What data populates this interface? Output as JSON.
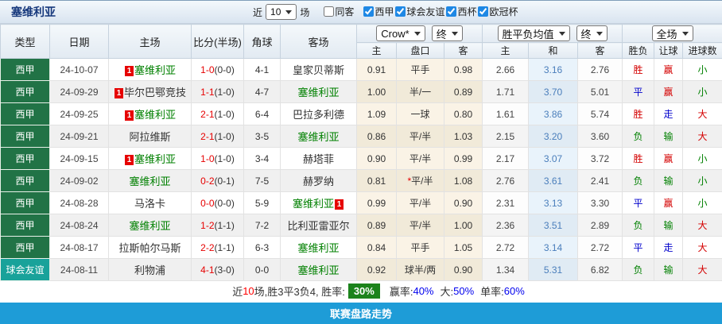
{
  "title": "塞维利亚",
  "toolbar": {
    "recent_label": "近",
    "matches_select": "10",
    "matches_label": "场",
    "checkboxes": [
      {
        "label": "同客",
        "checked": false
      },
      {
        "label": "西甲",
        "checked": true
      },
      {
        "label": "球会友谊",
        "checked": true
      },
      {
        "label": "西杯",
        "checked": true
      },
      {
        "label": "欧冠杯",
        "checked": true
      }
    ]
  },
  "table": {
    "headers": [
      "类型",
      "日期",
      "主场",
      "比分(半场)",
      "角球",
      "客场"
    ],
    "selects": {
      "odds_source": "Crow*",
      "odds_time": "终",
      "avg_source": "胜平负均值",
      "avg_time": "终",
      "scope": "全场"
    },
    "sub_headers": [
      "主",
      "盘口",
      "客",
      "主",
      "和",
      "客",
      "胜负",
      "让球",
      "进球数"
    ],
    "rows": [
      {
        "type": "西甲",
        "type_color": "league",
        "date": "24-10-07",
        "home_badge": "1",
        "home_name": "塞维利亚",
        "home_self": true,
        "home_badge_after": "",
        "score_ft": "1-0",
        "score_half": "(0-0)",
        "corner": "4-1",
        "away_badge": "",
        "away_name": "皇家贝蒂斯",
        "away_self": false,
        "away_badge_after": "",
        "crow_home": "0.91",
        "handicap_star": "",
        "handicap": "平手",
        "crow_away": "0.98",
        "avg_home": "2.66",
        "avg_draw": "3.16",
        "avg_away": "2.76",
        "res_wdl": "胜",
        "res_handicap": "赢",
        "res_goals": "小"
      },
      {
        "type": "西甲",
        "type_color": "league",
        "date": "24-09-29",
        "home_badge": "1",
        "home_name": "毕尔巴鄂竞技",
        "home_self": false,
        "home_badge_after": "",
        "score_ft": "1-1",
        "score_half": "(1-0)",
        "corner": "4-7",
        "away_badge": "",
        "away_name": "塞维利亚",
        "away_self": true,
        "away_badge_after": "",
        "crow_home": "1.00",
        "handicap_star": "",
        "handicap": "半/一",
        "crow_away": "0.89",
        "avg_home": "1.71",
        "avg_draw": "3.70",
        "avg_away": "5.01",
        "res_wdl": "平",
        "res_handicap": "赢",
        "res_goals": "小"
      },
      {
        "type": "西甲",
        "type_color": "league",
        "date": "24-09-25",
        "home_badge": "1",
        "home_name": "塞维利亚",
        "home_self": true,
        "home_badge_after": "",
        "score_ft": "2-1",
        "score_half": "(1-0)",
        "corner": "6-4",
        "away_badge": "",
        "away_name": "巴拉多利德",
        "away_self": false,
        "away_badge_after": "",
        "crow_home": "1.09",
        "handicap_star": "",
        "handicap": "一球",
        "crow_away": "0.80",
        "avg_home": "1.61",
        "avg_draw": "3.86",
        "avg_away": "5.74",
        "res_wdl": "胜",
        "res_handicap": "走",
        "res_goals": "大"
      },
      {
        "type": "西甲",
        "type_color": "league",
        "date": "24-09-21",
        "home_badge": "",
        "home_name": "阿拉维斯",
        "home_self": false,
        "home_badge_after": "",
        "score_ft": "2-1",
        "score_half": "(1-0)",
        "corner": "3-5",
        "away_badge": "",
        "away_name": "塞维利亚",
        "away_self": true,
        "away_badge_after": "",
        "crow_home": "0.86",
        "handicap_star": "",
        "handicap": "平/半",
        "crow_away": "1.03",
        "avg_home": "2.15",
        "avg_draw": "3.20",
        "avg_away": "3.60",
        "res_wdl": "负",
        "res_handicap": "输",
        "res_goals": "大"
      },
      {
        "type": "西甲",
        "type_color": "league",
        "date": "24-09-15",
        "home_badge": "1",
        "home_name": "塞维利亚",
        "home_self": true,
        "home_badge_after": "",
        "score_ft": "1-0",
        "score_half": "(1-0)",
        "corner": "3-4",
        "away_badge": "",
        "away_name": "赫塔菲",
        "away_self": false,
        "away_badge_after": "",
        "crow_home": "0.90",
        "handicap_star": "",
        "handicap": "平/半",
        "crow_away": "0.99",
        "avg_home": "2.17",
        "avg_draw": "3.07",
        "avg_away": "3.72",
        "res_wdl": "胜",
        "res_handicap": "赢",
        "res_goals": "小"
      },
      {
        "type": "西甲",
        "type_color": "league",
        "date": "24-09-02",
        "home_badge": "",
        "home_name": "塞维利亚",
        "home_self": true,
        "home_badge_after": "",
        "score_ft": "0-2",
        "score_half": "(0-1)",
        "corner": "7-5",
        "away_badge": "",
        "away_name": "赫罗纳",
        "away_self": false,
        "away_badge_after": "",
        "crow_home": "0.81",
        "handicap_star": "*",
        "handicap": "平/半",
        "crow_away": "1.08",
        "avg_home": "2.76",
        "avg_draw": "3.61",
        "avg_away": "2.41",
        "res_wdl": "负",
        "res_handicap": "输",
        "res_goals": "小"
      },
      {
        "type": "西甲",
        "type_color": "league",
        "date": "24-08-28",
        "home_badge": "",
        "home_name": "马洛卡",
        "home_self": false,
        "home_badge_after": "",
        "score_ft": "0-0",
        "score_half": "(0-0)",
        "corner": "5-9",
        "away_badge": "",
        "away_name": "塞维利亚",
        "away_self": true,
        "away_badge_after": "1",
        "crow_home": "0.99",
        "handicap_star": "",
        "handicap": "平/半",
        "crow_away": "0.90",
        "avg_home": "2.31",
        "avg_draw": "3.13",
        "avg_away": "3.30",
        "res_wdl": "平",
        "res_handicap": "赢",
        "res_goals": "小"
      },
      {
        "type": "西甲",
        "type_color": "league",
        "date": "24-08-24",
        "home_badge": "",
        "home_name": "塞维利亚",
        "home_self": true,
        "home_badge_after": "",
        "score_ft": "1-2",
        "score_half": "(1-1)",
        "corner": "7-2",
        "away_badge": "",
        "away_name": "比利亚雷亚尔",
        "away_self": false,
        "away_badge_after": "",
        "crow_home": "0.89",
        "handicap_star": "",
        "handicap": "平/半",
        "crow_away": "1.00",
        "avg_home": "2.36",
        "avg_draw": "3.51",
        "avg_away": "2.89",
        "res_wdl": "负",
        "res_handicap": "输",
        "res_goals": "大"
      },
      {
        "type": "西甲",
        "type_color": "league",
        "date": "24-08-17",
        "home_badge": "",
        "home_name": "拉斯帕尔马斯",
        "home_self": false,
        "home_badge_after": "",
        "score_ft": "2-2",
        "score_half": "(1-1)",
        "corner": "6-3",
        "away_badge": "",
        "away_name": "塞维利亚",
        "away_self": true,
        "away_badge_after": "",
        "crow_home": "0.84",
        "handicap_star": "",
        "handicap": "平手",
        "crow_away": "1.05",
        "avg_home": "2.72",
        "avg_draw": "3.14",
        "avg_away": "2.72",
        "res_wdl": "平",
        "res_handicap": "走",
        "res_goals": "大"
      },
      {
        "type": "球会友谊",
        "type_color": "friendly",
        "date": "24-08-11",
        "home_badge": "",
        "home_name": "利物浦",
        "home_self": false,
        "home_badge_after": "",
        "score_ft": "4-1",
        "score_half": "(3-0)",
        "corner": "0-0",
        "away_badge": "",
        "away_name": "塞维利亚",
        "away_self": true,
        "away_badge_after": "",
        "crow_home": "0.92",
        "handicap_star": "",
        "handicap": "球半/两",
        "crow_away": "0.90",
        "avg_home": "1.34",
        "avg_draw": "5.31",
        "avg_away": "6.82",
        "res_wdl": "负",
        "res_handicap": "输",
        "res_goals": "大"
      }
    ]
  },
  "summary": {
    "part1": "近",
    "count": "10",
    "part2": "场,胜3平3负4, 胜率:",
    "win_rate": "30%",
    "lbl_handicap": "赢率:",
    "val_handicap": "40%",
    "lbl_big": "大:",
    "val_big": "50%",
    "lbl_single": "单率:",
    "val_single": "60%"
  },
  "footer": {
    "label": "联赛盘路走势"
  },
  "colors": {
    "league_bg": "#217346",
    "friendly_bg": "#18a29a",
    "self_team": "#008000",
    "opp_team": "#333333",
    "score": "#e60000",
    "badge_bg": "#e60000",
    "win": "#d40000",
    "draw": "#0000cc",
    "lose": "#008000",
    "big": "#d40000",
    "small": "#008000",
    "draw_col_text": "#4a7ebb",
    "rate_badge_bg": "#1c831c",
    "percent_blue": "#0000ee",
    "count_red": "#ff0000",
    "footer_bg": "#1e9cd7",
    "title_text": "#16387c"
  }
}
